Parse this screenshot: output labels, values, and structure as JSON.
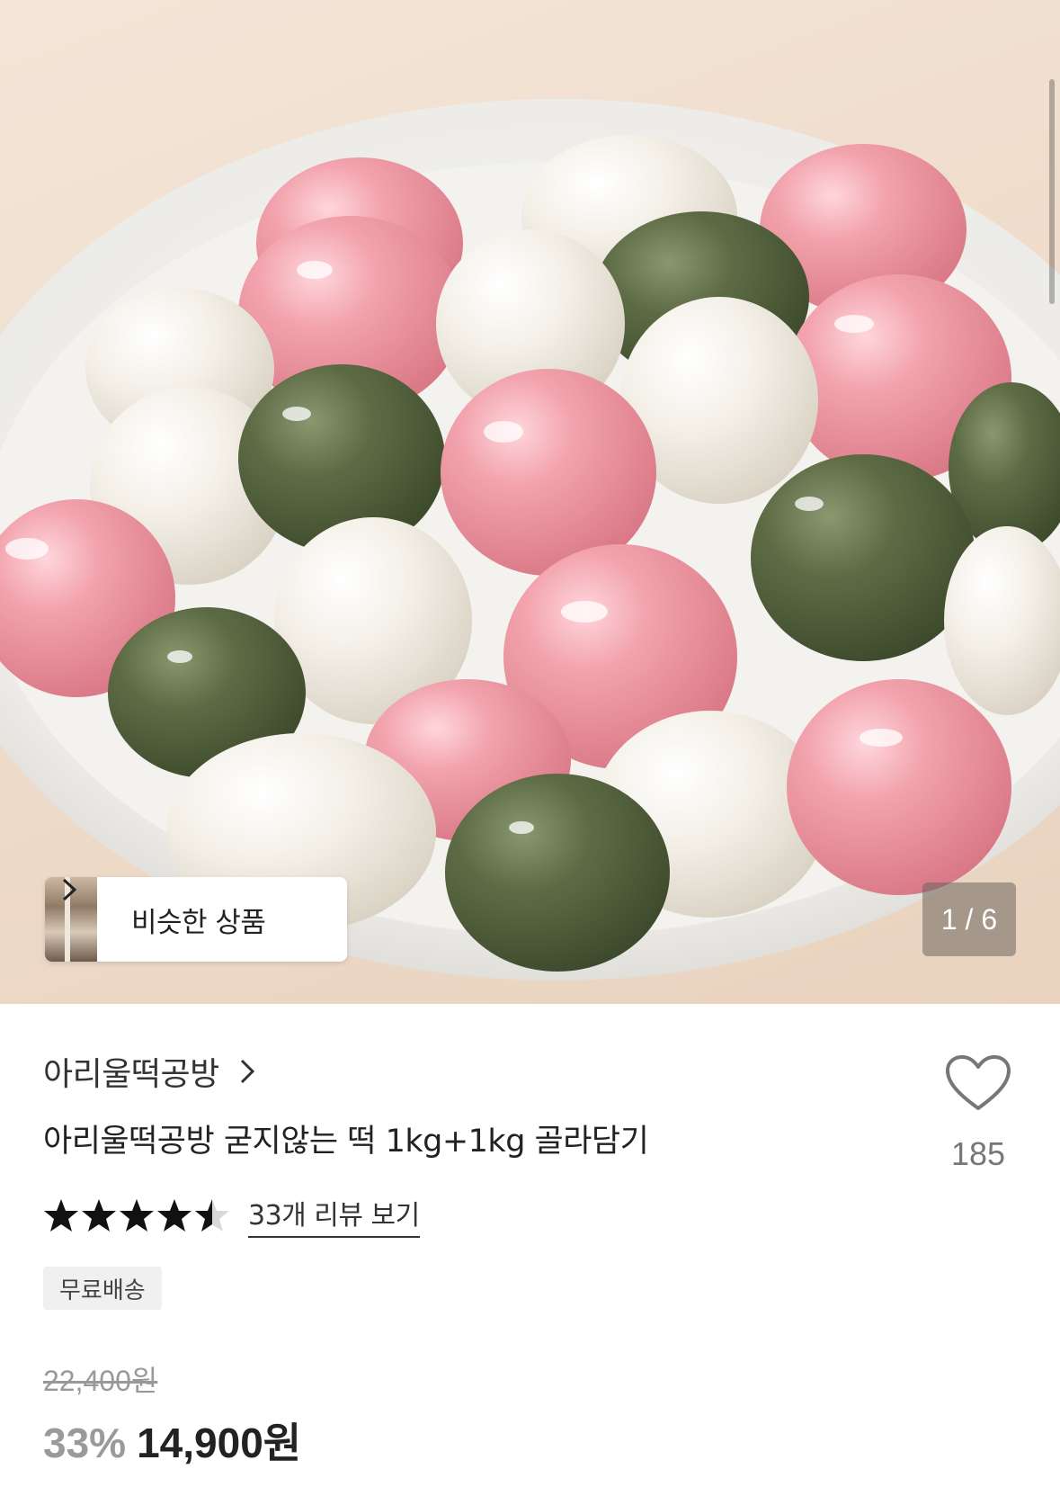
{
  "hero": {
    "similar_products_label": "비슷한 상품",
    "page_indicator": "1 / 6"
  },
  "product": {
    "store_name": "아리울떡공방",
    "title": "아리울떡공방 굳지않는 떡 1kg+1kg 골라담기",
    "wishlist_count": "185",
    "rating": 4.5,
    "review_link": "33개 리뷰 보기",
    "badge": "무료배송",
    "original_price": "22,400원",
    "discount": "33%",
    "final_price": "14,900원"
  },
  "icons": {
    "heart": "heart-outline-icon",
    "chevron": "chevron-right-icon",
    "star": "star-icon"
  }
}
